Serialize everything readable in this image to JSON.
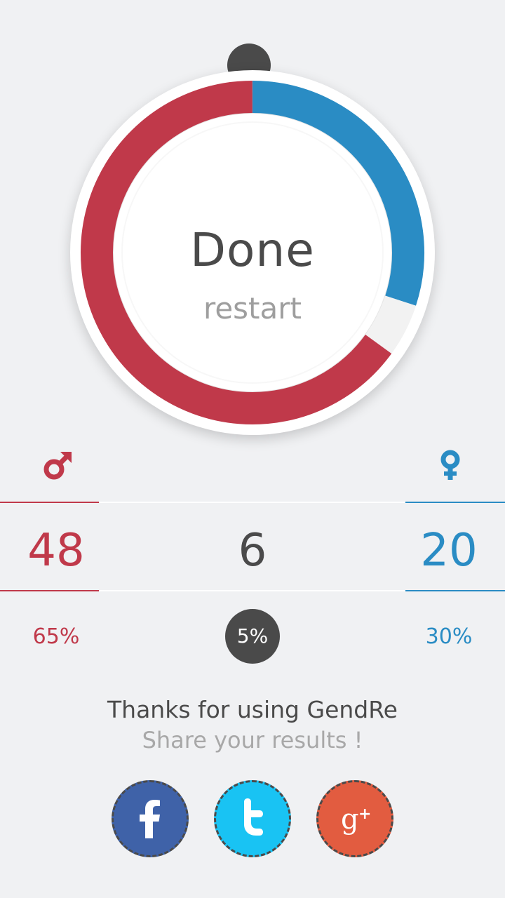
{
  "dial": {
    "title": "Done",
    "action_label": "restart",
    "male_share": 0.65,
    "female_share": 0.3,
    "neutral_share": 0.05,
    "colors": {
      "male": "#c0394a",
      "female": "#2a8cc4",
      "neutral": "#f2f2f2",
      "track": "#e6e6e6"
    }
  },
  "stats": {
    "male": {
      "icon": "male-icon",
      "count": "48",
      "percent": "65%"
    },
    "neutral": {
      "count": "6",
      "percent": "5%"
    },
    "female": {
      "icon": "female-icon",
      "count": "20",
      "percent": "30%"
    }
  },
  "footer": {
    "thanks": "Thanks for using GendRe",
    "share": "Share your results !"
  },
  "social": [
    {
      "name": "facebook",
      "icon": "facebook-icon",
      "color": "#3f62a8"
    },
    {
      "name": "twitter",
      "icon": "twitter-icon",
      "color": "#19c3f3"
    },
    {
      "name": "google-plus",
      "icon": "google-plus-icon",
      "color": "#e25c40"
    }
  ]
}
